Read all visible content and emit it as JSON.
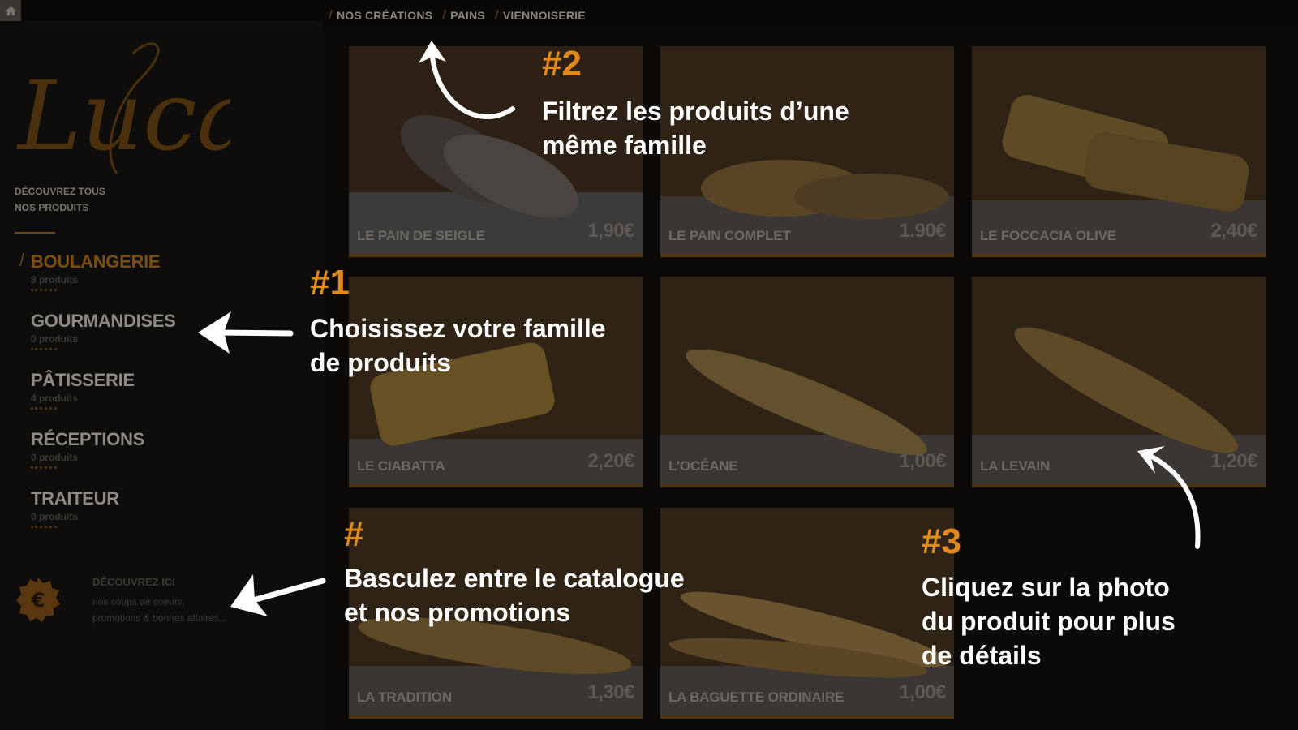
{
  "topbar": {
    "home_icon": "home-icon",
    "filters": [
      "NOS CRÉATIONS",
      "PAINS",
      "VIENNOISERIE"
    ]
  },
  "sidebar": {
    "logo_text": "Lucas",
    "discover_line1": "DÉCOUVREZ TOUS",
    "discover_line2": "NOS PRODUITS",
    "categories": [
      {
        "name": "BOULANGERIE",
        "count": "8 produits",
        "active": true
      },
      {
        "name": "GOURMANDISES",
        "count": "0 produits",
        "active": false
      },
      {
        "name": "PÂTISSERIE",
        "count": "4 produits",
        "active": false
      },
      {
        "name": "RÉCEPTIONS",
        "count": "0 produits",
        "active": false
      },
      {
        "name": "TRAITEUR",
        "count": "0 produits",
        "active": false
      }
    ],
    "promo": {
      "icon": "euro-badge-icon",
      "title": "DÉCOUVREZ ICI",
      "line1": "nos coups de coeurs,",
      "line2": "promotions & bonnes affaires..."
    }
  },
  "products": [
    {
      "name": "LE PAIN DE SEIGLE",
      "price": "1,90€"
    },
    {
      "name": "LE PAIN COMPLET",
      "price": "1.90€"
    },
    {
      "name": "LE FOCCACIA OLIVE",
      "price": "2,40€"
    },
    {
      "name": "LE CIABATTA",
      "price": "2,20€"
    },
    {
      "name": "L'OCÉANE",
      "price": "1,00€"
    },
    {
      "name": "LA LEVAIN",
      "price": "1,20€"
    },
    {
      "name": "LA TRADITION",
      "price": "1,30€"
    },
    {
      "name": "LA BAGUETTE ORDINAIRE",
      "price": "1,00€"
    }
  ],
  "annotations": {
    "a1": {
      "num": "#1",
      "line1": "Choisissez  votre famille",
      "line2": "de produits"
    },
    "a2": {
      "num": "#2",
      "line1": "Filtrez les produits d’une",
      "line2": "même famille"
    },
    "a3": {
      "num": "#3",
      "line1": "Cliquez sur la photo",
      "line2": "du produit pour plus",
      "line3": "de détails"
    },
    "a4": {
      "num": "#",
      "line1": "Basculez entre le catalogue",
      "line2": "et nos promotions"
    }
  },
  "colors": {
    "accent": "#e08a1e",
    "dim_accent": "#7a4e12",
    "background": "#0c0a08"
  }
}
